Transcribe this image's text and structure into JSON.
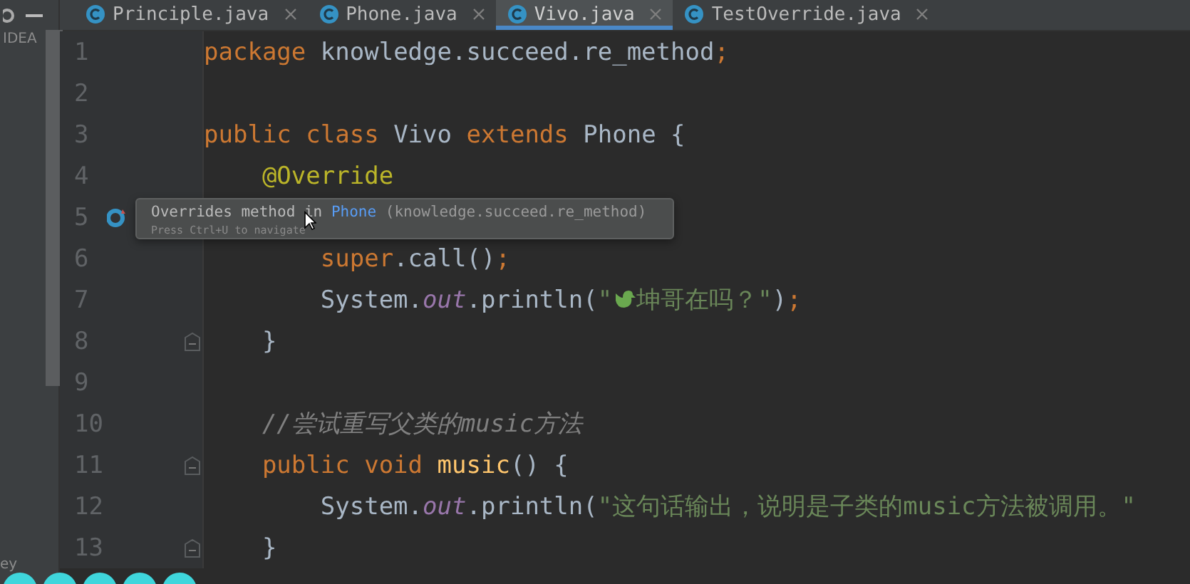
{
  "sidebar": {
    "labels": [
      "IDEA",
      "ey"
    ]
  },
  "tabs": [
    {
      "label": "Principle.java",
      "selected": false
    },
    {
      "label": "Phone.java",
      "selected": false
    },
    {
      "label": "Vivo.java",
      "selected": true
    },
    {
      "label": "TestOverride.java",
      "selected": false
    }
  ],
  "editor": {
    "lines": [
      {
        "number": "1",
        "tokens": [
          {
            "kind": "keyword",
            "text": "package "
          },
          {
            "kind": "plain",
            "text": "knowledge.succeed.re_method"
          },
          {
            "kind": "keyword",
            "text": ";"
          }
        ]
      },
      {
        "number": "2"
      },
      {
        "number": "3",
        "tokens": [
          {
            "kind": "keyword",
            "text": "public class "
          },
          {
            "kind": "plain",
            "text": "Vivo "
          },
          {
            "kind": "keyword",
            "text": "extends "
          },
          {
            "kind": "plain",
            "text": "Phone {"
          }
        ]
      },
      {
        "number": "4",
        "tokens": [
          {
            "kind": "annotation",
            "text": "    @Override"
          }
        ]
      },
      {
        "number": "5",
        "overrides": true
      },
      {
        "number": "6",
        "tokens": [
          {
            "kind": "keyword",
            "text": "        super"
          },
          {
            "kind": "plain",
            "text": ".call()"
          },
          {
            "kind": "keyword",
            "text": ";"
          }
        ]
      },
      {
        "number": "7",
        "tokens": [
          {
            "kind": "plain",
            "text": "        System."
          },
          {
            "kind": "field",
            "text": "out"
          },
          {
            "kind": "plain",
            "text": ".println("
          },
          {
            "kind": "string",
            "text": "\""
          },
          {
            "kind": "bird"
          },
          {
            "kind": "string",
            "text": "坤哥在吗？\""
          },
          {
            "kind": "plain",
            "text": ")"
          },
          {
            "kind": "keyword",
            "text": ";"
          }
        ]
      },
      {
        "number": "8",
        "fold": true,
        "tokens": [
          {
            "kind": "plain",
            "text": "    }"
          }
        ]
      },
      {
        "number": "9"
      },
      {
        "number": "10",
        "tokens": [
          {
            "kind": "comment",
            "text": "    //尝试重写父类的music方法"
          }
        ]
      },
      {
        "number": "11",
        "fold": true,
        "tokens": [
          {
            "kind": "keyword",
            "text": "    public void "
          },
          {
            "kind": "method",
            "text": "music"
          },
          {
            "kind": "plain",
            "text": "() {"
          }
        ]
      },
      {
        "number": "12",
        "tokens": [
          {
            "kind": "plain",
            "text": "        System."
          },
          {
            "kind": "field",
            "text": "out"
          },
          {
            "kind": "plain",
            "text": ".println("
          },
          {
            "kind": "string",
            "text": "\"这句话输出，说明是子类的music方法被调用。\""
          }
        ]
      },
      {
        "number": "13",
        "fold": true,
        "tokens": [
          {
            "kind": "plain",
            "text": "    }"
          }
        ]
      }
    ]
  },
  "tooltip": {
    "before": "Overrides method in ",
    "link": "Phone",
    "after": " (knowledge.succeed.re_method)",
    "hint": "Press Ctrl+U to navigate"
  }
}
